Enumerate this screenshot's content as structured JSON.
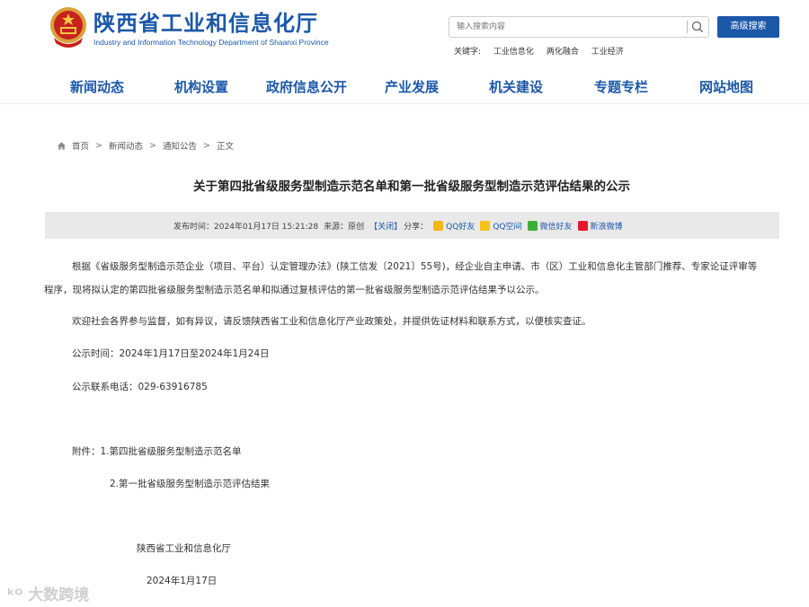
{
  "header": {
    "site_name": "陕西省工业和信息化厅",
    "site_name_en": "Industry and Information Technology Department of Shaanxi Province",
    "search_placeholder": "输入搜索内容",
    "advanced_search_label": "高级搜索",
    "keywords_label": "关键字:",
    "keywords": [
      "工业信息化",
      "两化融合",
      "工业经济"
    ]
  },
  "nav": {
    "items": [
      "新闻动态",
      "机构设置",
      "政府信息公开",
      "产业发展",
      "机关建设",
      "专题专栏",
      "网站地图"
    ]
  },
  "breadcrumb": {
    "items": [
      "首页",
      "新闻动态",
      "通知公告",
      "正文"
    ],
    "separator": ">"
  },
  "article": {
    "title": "关于第四批省级服务型制造示范名单和第一批省级服务型制造示范评估结果的公示",
    "meta": {
      "publish_label": "发布时间：",
      "publish_time": "2024年01月17日 15:21:28",
      "source_label": "来源：",
      "source": "原创",
      "close_label": "【关闭】",
      "share_label": "分享：",
      "share_items": [
        "QQ好友",
        "QQ空间",
        "微信好友",
        "新浪微博"
      ]
    },
    "paragraphs": [
      "根据《省级服务型制造示范企业（项目、平台）认定管理办法》(陕工信发〔2021〕55号)，经企业自主申请、市（区）工业和信息化主管部门推荐、专家论证评审等",
      "程序，现将拟认定的第四批省级服务型制造示范名单和拟通过复核评估的第一批省级服务型制造示范评估结果予以公示。",
      "欢迎社会各界参与监督，如有异议，请反馈陕西省工业和信息化厅产业政策处，并提供佐证材料和联系方式，以便核实查证。",
      "公示时间：2024年1月17日至2024年1月24日",
      "公示联系电话：029-63916785",
      "附件：1.第四批省级服务型制造示范名单",
      "2.第一批省级服务型制造示范评估结果",
      "陕西省工业和信息化厅",
      "2024年1月17日"
    ]
  },
  "watermark": "大数跨境",
  "colors": {
    "brand": "#1c58a8",
    "meta_bg": "#e9e9e9"
  }
}
